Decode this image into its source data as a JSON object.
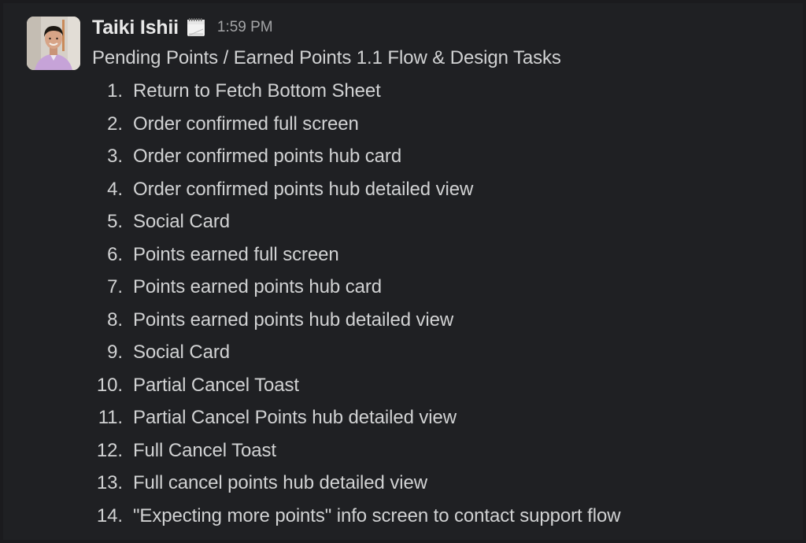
{
  "message": {
    "author": "Taiki Ishii",
    "status_emoji": "calendar-icon",
    "timestamp": "1:59 PM",
    "title": "Pending Points / Earned Points 1.1 Flow & Design Tasks",
    "tasks": [
      {
        "num": "1.",
        "text": "Return to Fetch Bottom Sheet"
      },
      {
        "num": "2.",
        "text": "Order confirmed full screen"
      },
      {
        "num": "3.",
        "text": "Order confirmed points hub card"
      },
      {
        "num": "4.",
        "text": "Order confirmed points hub detailed view"
      },
      {
        "num": "5.",
        "text": "Social Card"
      },
      {
        "num": "6.",
        "text": "Points earned full screen"
      },
      {
        "num": "7.",
        "text": "Points earned points hub card"
      },
      {
        "num": "8.",
        "text": "Points earned points hub detailed view"
      },
      {
        "num": "9.",
        "text": "Social Card"
      },
      {
        "num": "10.",
        "text": "Partial Cancel Toast"
      },
      {
        "num": "11.",
        "text": "Partial Cancel Points hub detailed view"
      },
      {
        "num": "12.",
        "text": "Full Cancel Toast"
      },
      {
        "num": "13.",
        "text": "Full cancel points hub detailed view"
      },
      {
        "num": "14.",
        "text": "\"Expecting more points\" info screen to contact support flow"
      }
    ]
  },
  "colors": {
    "background": "#1f2023",
    "text": "#d1d2d3",
    "author": "#e8e8e8",
    "timestamp": "#a4a5a7"
  }
}
